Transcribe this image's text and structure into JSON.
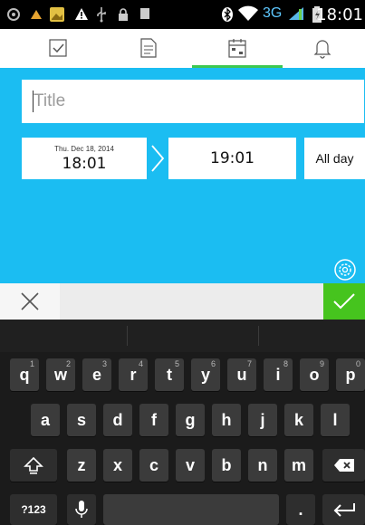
{
  "status_bar": {
    "network": "3G",
    "time": "18:01"
  },
  "tabs": [
    {
      "name": "tasks",
      "icon": "checkbox-icon",
      "selected": false
    },
    {
      "name": "notes",
      "icon": "document-icon",
      "selected": false
    },
    {
      "name": "calendar",
      "icon": "calendar-icon",
      "selected": true
    },
    {
      "name": "reminders",
      "icon": "bell-icon",
      "selected": false
    }
  ],
  "event_form": {
    "title_placeholder": "Title",
    "start_date": "Thu. Dec 18, 2014",
    "start_time": "18:01",
    "end_time": "19:01",
    "all_day_label": "All day"
  },
  "colors": {
    "accent_blue": "#1bbdf2",
    "confirm_green": "#46c41e",
    "tab_indicator": "#3cc850"
  },
  "keyboard": {
    "row1": [
      {
        "label": "q",
        "hint": "1"
      },
      {
        "label": "w",
        "hint": "2"
      },
      {
        "label": "e",
        "hint": "3"
      },
      {
        "label": "r",
        "hint": "4"
      },
      {
        "label": "t",
        "hint": "5"
      },
      {
        "label": "y",
        "hint": "6"
      },
      {
        "label": "u",
        "hint": "7"
      },
      {
        "label": "i",
        "hint": "8"
      },
      {
        "label": "o",
        "hint": "9"
      },
      {
        "label": "p",
        "hint": "0"
      }
    ],
    "row2": [
      "a",
      "s",
      "d",
      "f",
      "g",
      "h",
      "j",
      "k",
      "l"
    ],
    "row3": [
      "z",
      "x",
      "c",
      "v",
      "b",
      "n",
      "m"
    ],
    "symbols_label": "?123",
    "period_label": "."
  }
}
